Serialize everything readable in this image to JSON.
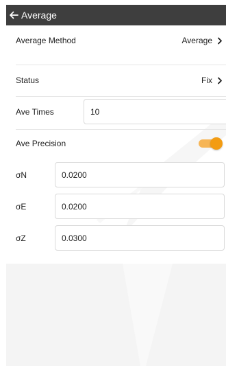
{
  "header": {
    "title": "Average",
    "back_icon": "arrow-left-icon"
  },
  "settings": {
    "average_method": {
      "label": "Average Method",
      "value": "Average"
    },
    "status": {
      "label": "Status",
      "value": "Fix"
    },
    "ave_times": {
      "label": "Ave Times",
      "value": "10"
    },
    "ave_precision": {
      "label": "Ave Precision",
      "enabled": true,
      "accent": "#f39c12"
    },
    "sigma_n": {
      "label": "σN",
      "value": "0.0200"
    },
    "sigma_e": {
      "label": "σE",
      "value": "0.0200"
    },
    "sigma_z": {
      "label": "σZ",
      "value": "0.0300"
    }
  },
  "colors": {
    "appbar": "#3e3e3e",
    "toggle_on": "#f39c12"
  }
}
